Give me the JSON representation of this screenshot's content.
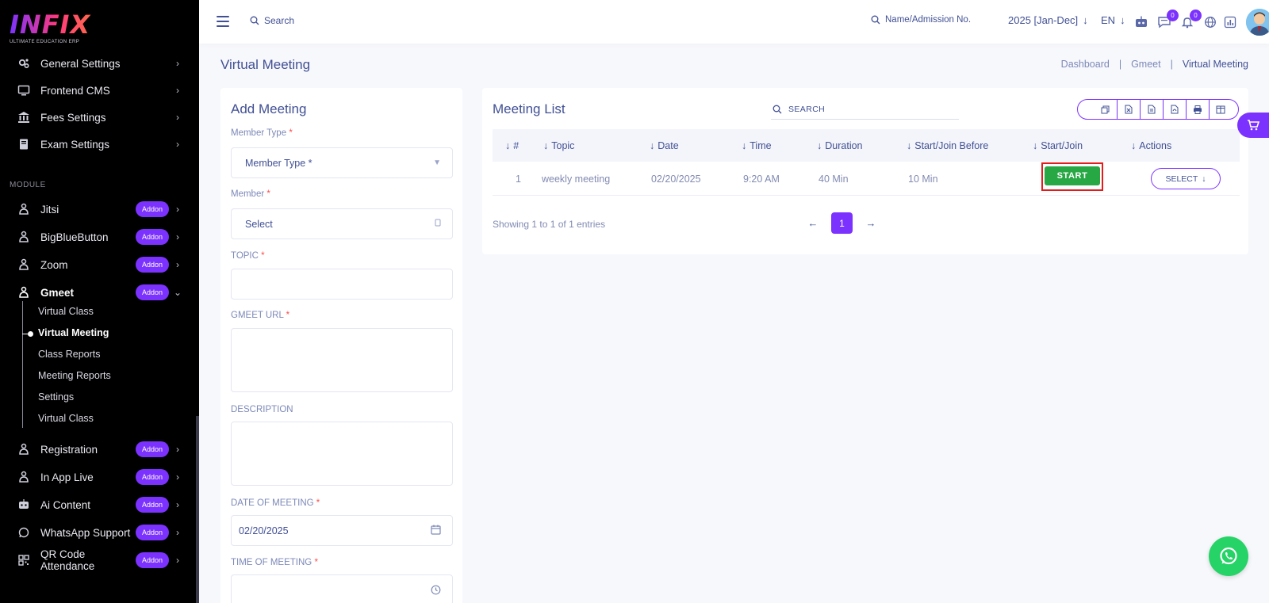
{
  "brand": {
    "logo_text": "INFIX",
    "tagline": "ULTIMATE EDUCATION ERP"
  },
  "sidebar": {
    "top_items": [
      {
        "label": "General Settings",
        "icon": "gears-icon"
      },
      {
        "label": "Frontend CMS",
        "icon": "monitor-icon"
      },
      {
        "label": "Fees Settings",
        "icon": "bank-icon"
      },
      {
        "label": "Exam Settings",
        "icon": "book-icon"
      }
    ],
    "module_label": "MODULE",
    "module_items": [
      {
        "label": "Jitsi",
        "badge": "Addon"
      },
      {
        "label": "BigBlueButton",
        "badge": "Addon"
      },
      {
        "label": "Zoom",
        "badge": "Addon"
      },
      {
        "label": "Gmeet",
        "badge": "Addon"
      }
    ],
    "gmeet_submenu": [
      "Virtual Class",
      "Virtual Meeting",
      "Class Reports",
      "Meeting Reports",
      "Settings",
      "Virtual Class"
    ],
    "bottom_items": [
      {
        "label": "Registration",
        "badge": "Addon"
      },
      {
        "label": "In App Live",
        "badge": "Addon"
      },
      {
        "label": "Ai Content",
        "badge": "Addon"
      },
      {
        "label": "WhatsApp Support",
        "badge": "Addon"
      },
      {
        "label": "QR Code Attendance",
        "badge": "Addon"
      }
    ]
  },
  "header": {
    "search_label": "Search",
    "name_search_label": "Name/Admission No.",
    "year": "2025 [Jan-Dec]",
    "language": "EN",
    "messages_count": "0",
    "notifications_count": "0"
  },
  "page": {
    "title": "Virtual Meeting",
    "breadcrumb": [
      "Dashboard",
      "Gmeet",
      "Virtual Meeting"
    ],
    "separator": "|"
  },
  "form": {
    "title": "Add Meeting",
    "member_type_label": "Member Type",
    "member_type_value": "Member Type *",
    "member_label": "Member",
    "member_value": "Select",
    "topic_label": "TOPIC",
    "gmeet_url_label": "GMEET URL",
    "description_label": "DESCRIPTION",
    "date_label": "DATE OF MEETING",
    "date_value": "02/20/2025",
    "time_label": "TIME OF MEETING",
    "required_mark": "*"
  },
  "meeting_list": {
    "title": "Meeting List",
    "search_placeholder": "SEARCH",
    "columns": [
      "#",
      "Topic",
      "Date",
      "Time",
      "Duration",
      "Start/Join Before",
      "Start/Join",
      "Actions"
    ],
    "rows": [
      {
        "index": "1",
        "topic": "weekly meeting",
        "date": "02/20/2025",
        "time": "9:20 AM",
        "duration": "40 Min",
        "before": "10 Min",
        "start_label": "START",
        "actions_label": "SELECT"
      }
    ],
    "footer_text": "Showing 1 to 1 of 1 entries",
    "current_page": "1"
  },
  "colors": {
    "accent": "#7c32ff",
    "start_green": "#28a745",
    "highlight_red": "#e41b1b",
    "text_primary": "#415094",
    "sidebar_bg": "#000000"
  }
}
